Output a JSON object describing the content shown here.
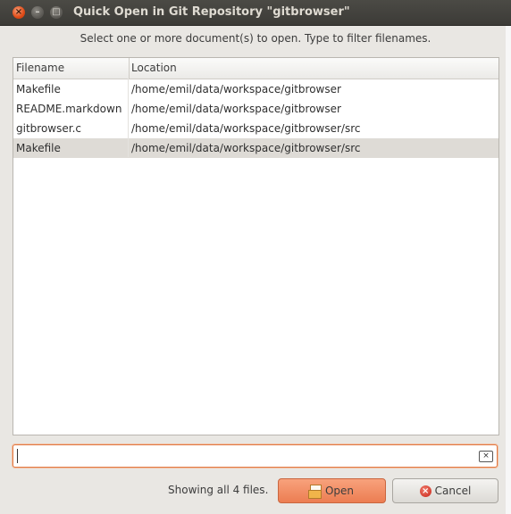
{
  "window": {
    "title": "Quick Open in Git Repository \"gitbrowser\"",
    "close_glyph": "×",
    "minimize_glyph": "–",
    "maximize_glyph": "□"
  },
  "instruction": "Select one or more document(s) to open. Type to filter filenames.",
  "table": {
    "columns": {
      "filename": "Filename",
      "location": "Location"
    },
    "rows": [
      {
        "filename": "Makefile",
        "location": "/home/emil/data/workspace/gitbrowser",
        "selected": false
      },
      {
        "filename": "README.markdown",
        "location": "/home/emil/data/workspace/gitbrowser",
        "selected": false
      },
      {
        "filename": "gitbrowser.c",
        "location": "/home/emil/data/workspace/gitbrowser/src",
        "selected": false
      },
      {
        "filename": "Makefile",
        "location": "/home/emil/data/workspace/gitbrowser/src",
        "selected": true
      }
    ]
  },
  "filter": {
    "value": "",
    "clear_icon": "clear-text-icon"
  },
  "status": "Showing all 4 files.",
  "buttons": {
    "open_label": "Open",
    "open_icon": "open-document-icon",
    "cancel_label": "Cancel",
    "cancel_icon": "cancel-icon"
  },
  "colors": {
    "accent": "#ec7d52",
    "selection": "#dedbd6",
    "titlebar": "#3c3b37"
  }
}
